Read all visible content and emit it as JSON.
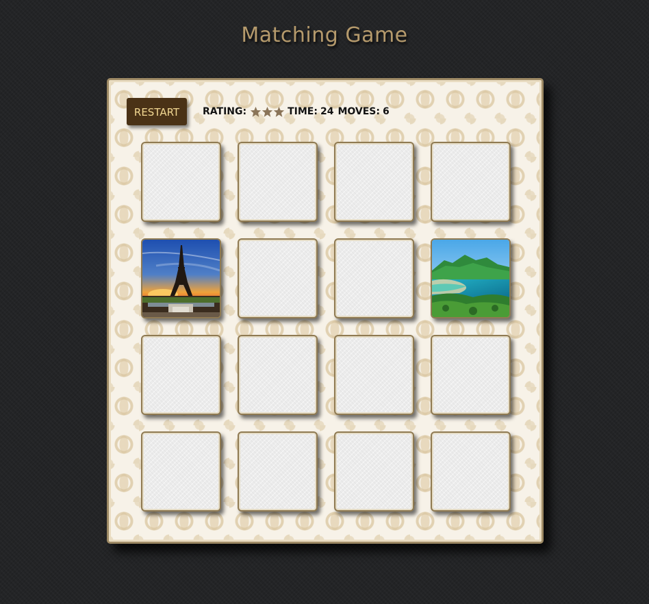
{
  "header": {
    "title": "Matching Game"
  },
  "controls": {
    "restart_label": "RESTART",
    "rating_label": "RATING:",
    "rating_stars": 3,
    "time_label": "TIME:",
    "time_value": "24",
    "moves_label": "MOVES:",
    "moves_value": "6"
  },
  "colors": {
    "background": "#232426",
    "title": "#b59a6c",
    "restart_bg": "#4a3216",
    "restart_text": "#f2d892",
    "card_border": "#8f7a52",
    "star": "#8a7458"
  },
  "board": {
    "rows": 4,
    "columns": 4,
    "cards": [
      {
        "state": "hidden"
      },
      {
        "state": "hidden"
      },
      {
        "state": "hidden"
      },
      {
        "state": "hidden"
      },
      {
        "state": "revealed",
        "image": "eiffel-tower-sunset"
      },
      {
        "state": "hidden"
      },
      {
        "state": "hidden"
      },
      {
        "state": "revealed",
        "image": "tropical-coast-mountains"
      },
      {
        "state": "hidden"
      },
      {
        "state": "hidden"
      },
      {
        "state": "hidden"
      },
      {
        "state": "hidden"
      },
      {
        "state": "hidden"
      },
      {
        "state": "hidden"
      },
      {
        "state": "hidden"
      },
      {
        "state": "hidden"
      }
    ]
  }
}
